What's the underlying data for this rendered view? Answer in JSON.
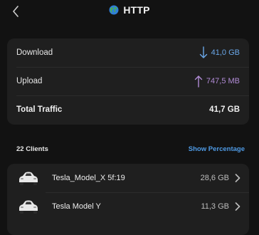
{
  "header": {
    "title": "HTTP",
    "back_icon": "chevron-left-icon",
    "title_icon": "globe-icon"
  },
  "traffic": {
    "download": {
      "label": "Download",
      "value": "41,0 GB",
      "icon": "arrow-down-icon",
      "color": "#6aa7e8"
    },
    "upload": {
      "label": "Upload",
      "value": "747,5 MB",
      "icon": "arrow-up-icon",
      "color": "#b18bd6"
    },
    "total": {
      "label": "Total Traffic",
      "value": "41,7 GB"
    }
  },
  "clients_section": {
    "count_label": "22 Clients",
    "toggle_label": "Show Percentage"
  },
  "clients": [
    {
      "name": "Tesla_Model_X 5f:19",
      "size": "28,6 GB",
      "icon": "car-icon"
    },
    {
      "name": "Tesla Model Y",
      "size": "11,3 GB",
      "icon": "car-icon"
    }
  ]
}
